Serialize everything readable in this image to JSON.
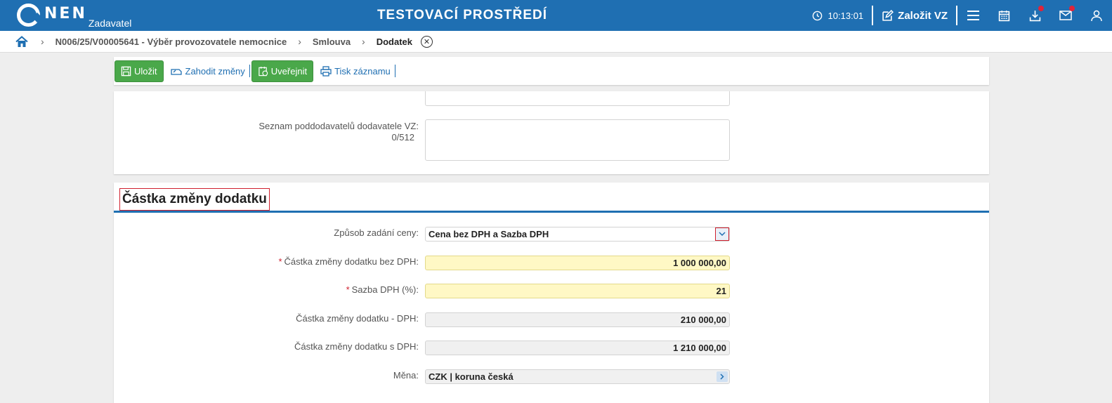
{
  "header": {
    "logo_text": "NEN",
    "logo_sub": "Zadavatel",
    "env_title": "TESTOVACÍ PROSTŘEDÍ",
    "time": "10:13:01",
    "create_label": "Založit VZ"
  },
  "breadcrumb": {
    "items": [
      "N006/25/V00005641 - Výběr provozovatele nemocnice",
      "Smlouva",
      "Dodatek"
    ]
  },
  "toolbar": {
    "save_label": "Uložit",
    "discard_label": "Zahodit změny",
    "publish_label": "Uveřejnit",
    "print_label": "Tisk záznamu"
  },
  "panel1": {
    "subcontractors_label": "Seznam poddodavatelů dodavatele VZ:",
    "subcontractors_counter": "0/512"
  },
  "section": {
    "title": "Částka změny dodatku",
    "fields": {
      "price_mode_label": "Způsob zadání ceny:",
      "price_mode_value": "Cena bez DPH a Sazba DPH",
      "amount_no_vat_label": "Částka změny dodatku bez DPH:",
      "amount_no_vat_value": "1 000 000,00",
      "vat_rate_label": "Sazba DPH (%):",
      "vat_rate_value": "21",
      "vat_amount_label": "Částka změny dodatku - DPH:",
      "vat_amount_value": "210 000,00",
      "amount_with_vat_label": "Částka změny dodatku s DPH:",
      "amount_with_vat_value": "1 210 000,00",
      "currency_label": "Měna:",
      "currency_value": "CZK | koruna česká"
    }
  },
  "colors": {
    "brand_blue": "#1f6fb2",
    "green_button": "#4aa84a",
    "required_bg": "#fff8c5",
    "notification_dot": "#e0243a"
  }
}
